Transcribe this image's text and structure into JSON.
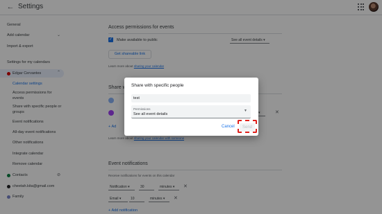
{
  "topbar": {
    "back_icon": "←",
    "title": "Settings"
  },
  "sidebar": {
    "general": "General",
    "add_calendar": "Add calendar",
    "import_export": "Import & export",
    "my_calendars_heading": "Settings for my calendars",
    "active_calendar": "Edgar Cervantes",
    "active_calendar_color": "#d50000",
    "subitems": [
      "Calendar settings",
      "Access permissions for events",
      "Share with specific people or groups",
      "Event notifications",
      "All-day event notifications",
      "Other notifications",
      "Integrate calendar",
      "Remove calendar"
    ],
    "other_calendars": [
      {
        "label": "Contacts",
        "color": "#0b8043"
      },
      {
        "label": "cheetah.kita@gmail.com",
        "color": "#202124"
      },
      {
        "label": "Family",
        "color": "#7986cb"
      }
    ]
  },
  "main": {
    "access_title": "Access permissions for events",
    "make_public": "Make available to public",
    "see_all_details": "See all event details",
    "get_link": "Get shareable link",
    "learn_sharing": "Learn more about",
    "learn_sharing_link": "sharing your calendar",
    "share_title": "Share w",
    "share_learn": "Learn more about",
    "share_learn_link": "sharing your calendar with someone",
    "add_people_short": "Ad",
    "notifications_title": "Event notifications",
    "notifications_desc": "Receive notifications for events on this calendar",
    "notif_rows": [
      {
        "type": "Notification",
        "value": "30",
        "unit": "minutes"
      },
      {
        "type": "Email",
        "value": "10",
        "unit": "minutes"
      }
    ],
    "add_notification": "Add notification"
  },
  "dialog": {
    "title": "Share with specific people",
    "input_value": "test",
    "permissions_label": "Permissions",
    "permissions_value": "See all event details",
    "cancel": "Cancel",
    "send": "Send"
  },
  "colors": {
    "accent": "#1a73e8",
    "highlight": "#e0201b"
  }
}
